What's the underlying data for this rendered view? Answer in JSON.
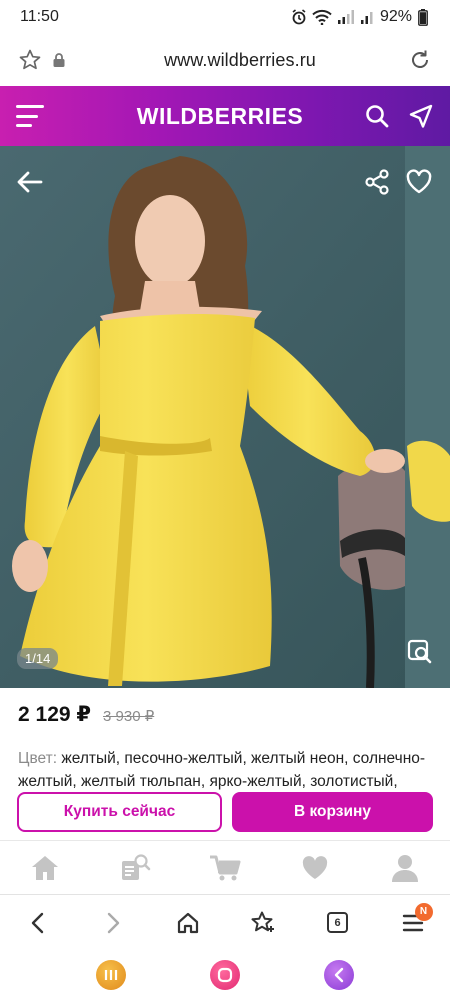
{
  "status": {
    "time": "11:50",
    "battery": "92%"
  },
  "browser": {
    "url": "www.wildberries.ru",
    "tab_count": "6",
    "menu_badge": "N"
  },
  "header": {
    "brand": "WILDBERRIES"
  },
  "product": {
    "image_counter": "1/14",
    "price_current": "2 129 ₽",
    "price_old": "3 930 ₽",
    "color_label": "Цвет:",
    "color_values": "желтый, песочно-желтый, желтый неон, солнечно-желтый, желтый тюльпан, ярко-желтый, золотистый,"
  },
  "actions": {
    "buy_now": "Купить сейчас",
    "add_to_cart": "В корзину"
  },
  "colors": {
    "brand": "#cb11ab",
    "header_gradient_start": "#c81fb0",
    "header_gradient_end": "#5f1aa3",
    "badge": "#f26a2e"
  },
  "icons": {
    "site_nav": [
      "home-icon",
      "catalog-search-icon",
      "cart-icon",
      "favorites-heart-icon",
      "profile-icon"
    ],
    "browser_nav": [
      "back-icon",
      "forward-icon",
      "home-icon",
      "bookmark-star-icon",
      "tabs-icon",
      "menu-icon"
    ]
  }
}
